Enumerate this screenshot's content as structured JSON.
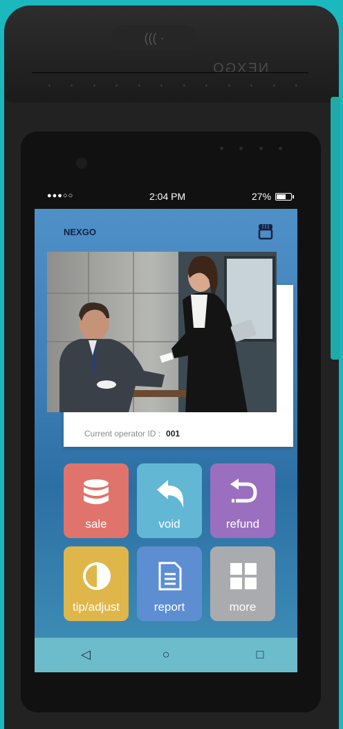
{
  "status_bar": {
    "signal": "●●●○○",
    "time": "2:04 PM",
    "battery": "27%",
    "battery_level": 0.27
  },
  "app": {
    "title": "NEXGO",
    "brand_mark": "NEXGO"
  },
  "operator": {
    "label": "Current operator ID :",
    "value": "001"
  },
  "tiles": [
    {
      "label": "sale",
      "icon": "database-icon",
      "color": "#e0736b"
    },
    {
      "label": "void",
      "icon": "undo-arrow-icon",
      "color": "#62b7d5"
    },
    {
      "label": "refund",
      "icon": "return-arrow-icon",
      "color": "#9a6fc0"
    },
    {
      "label": "tip/adjust",
      "icon": "half-circle-icon",
      "color": "#dfb64a"
    },
    {
      "label": "report",
      "icon": "document-icon",
      "color": "#5c8ed1"
    },
    {
      "label": "more",
      "icon": "grid-icon",
      "color": "#a9abae"
    }
  ],
  "nav": {
    "back": "◁",
    "home": "○",
    "recent": "□"
  }
}
